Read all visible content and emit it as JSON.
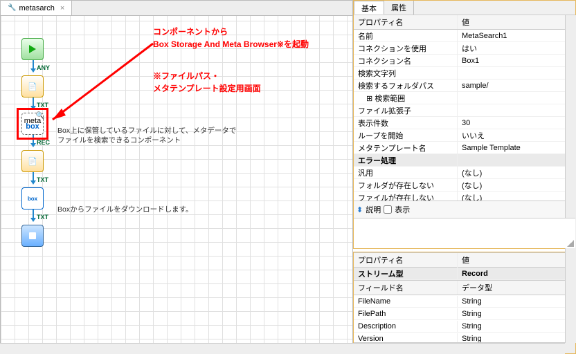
{
  "tab": {
    "title": "metasarch",
    "close": "×"
  },
  "annotations": {
    "line1": "コンポーネントから",
    "line2": "Box Storage And Meta Browser※を起動",
    "line3": "※ファイルパス・",
    "line4": "メタテンプレート設定用画面"
  },
  "nodeTags": {
    "any": "ANY",
    "txt": "TXT",
    "rec": "REC"
  },
  "canvasDesc": {
    "meta1": "Box上に保管しているファイルに対して、メタデータで",
    "meta2": "ファイルを検索できるコンポーネント",
    "dl": "Boxからファイルをダウンロードします。"
  },
  "rightTabs": {
    "basic": "基本",
    "attr": "属性"
  },
  "propHeader": {
    "name": "プロパティ名",
    "value": "値"
  },
  "props": [
    {
      "k": "名前",
      "v": "MetaSearch1"
    },
    {
      "k": "コネクションを使用",
      "v": "はい"
    },
    {
      "k": "コネクション名",
      "v": "Box1"
    },
    {
      "k": "検索文字列",
      "v": ""
    },
    {
      "k": "検索するフォルダパス",
      "v": "sample/"
    },
    {
      "k_indent": true,
      "k": "検索範囲",
      "v": ""
    },
    {
      "k": "ファイル拡張子",
      "v": ""
    },
    {
      "k": "表示件数",
      "v": "30"
    },
    {
      "k": "ループを開始",
      "v": "いいえ"
    },
    {
      "k": "メタテンプレート名",
      "v": "Sample Template"
    },
    {
      "group": true,
      "k": "エラー処理",
      "v": ""
    },
    {
      "k": "汎用",
      "v": "(なし)"
    },
    {
      "k": "フォルダが存在しない",
      "v": "(なし)"
    },
    {
      "k": "ファイルが存在しない",
      "v": "(なし)"
    }
  ],
  "descBar": {
    "label": "説明",
    "toggle": "表示"
  },
  "streamHeader": {
    "name": "プロパティ名",
    "value": "値"
  },
  "stream": [
    {
      "k": "ストリーム型",
      "v": "Record",
      "group": true
    }
  ],
  "fieldsHeader": {
    "name": "フィールド名",
    "value": "データ型"
  },
  "fields": [
    {
      "k": "FileName",
      "v": "String"
    },
    {
      "k": "FilePath",
      "v": "String"
    },
    {
      "k": "Description",
      "v": "String"
    },
    {
      "k": "Version",
      "v": "String"
    }
  ],
  "boxmeta": {
    "t1": "meta",
    "t2": "box"
  },
  "boxdl": "box"
}
